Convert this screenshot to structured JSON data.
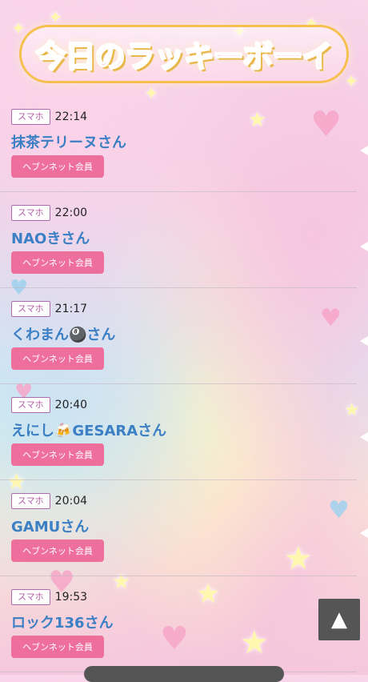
{
  "header": {
    "title": "今日のラッキーボーイ"
  },
  "entries": [
    {
      "device": "スマホ",
      "time": "22:14",
      "name": "抹茶テリーヌさん",
      "badge": "ヘブンネット会員"
    },
    {
      "device": "スマホ",
      "time": "22:00",
      "name": "NAOきさん",
      "badge": "ヘブンネット会員"
    },
    {
      "device": "スマホ",
      "time": "21:17",
      "name": "くわまん🎱さん",
      "badge": "ヘブンネット会員"
    },
    {
      "device": "スマホ",
      "time": "20:40",
      "name": "えにし🍻GESARAさん",
      "badge": "ヘブンネット会員"
    },
    {
      "device": "スマホ",
      "time": "20:04",
      "name": "GAMUさん",
      "badge": "ヘブンネット会員"
    },
    {
      "device": "スマホ",
      "time": "19:53",
      "name": "ロック136さん",
      "badge": "ヘブンネット会員"
    }
  ],
  "controls": {
    "scroll_top_glyph": "▲"
  },
  "colors": {
    "name": "#3b7fc4",
    "badge": "#ee6f9c",
    "device_border": "#b06ab0"
  }
}
